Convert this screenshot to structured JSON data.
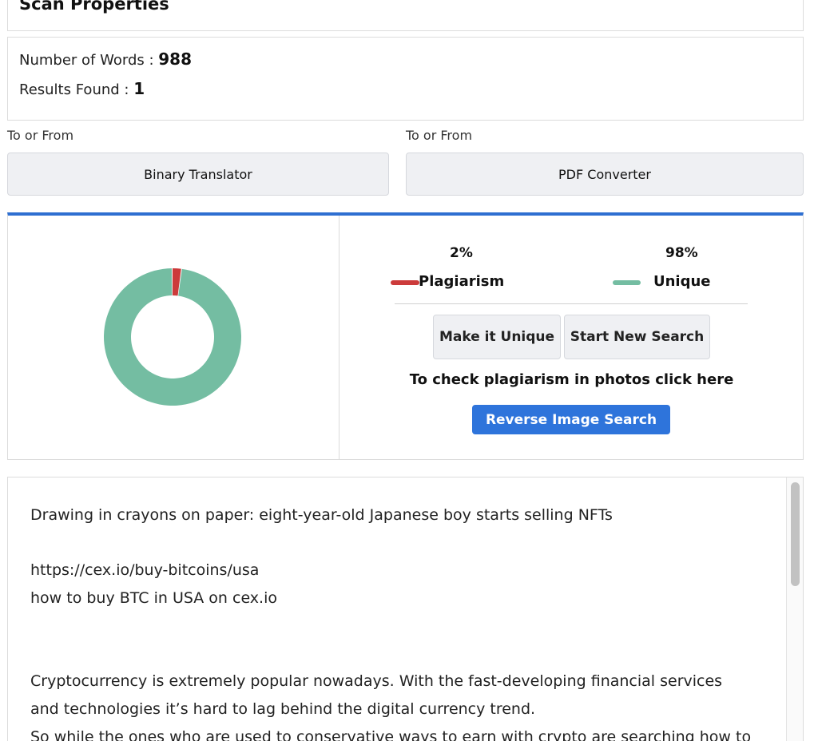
{
  "header": {
    "title": "Scan Properties"
  },
  "stats": {
    "words_label": "Number of Words : ",
    "words_value": "988",
    "results_label": "Results Found : ",
    "results_value": "1"
  },
  "tools": [
    {
      "label": "To or From",
      "button": "Binary Translator"
    },
    {
      "label": "To or From",
      "button": "PDF Converter"
    }
  ],
  "results": {
    "plagiarism": {
      "percent_text": "2%",
      "label": "Plagiarism",
      "value": 2,
      "color": "#cc3b3b"
    },
    "unique": {
      "percent_text": "98%",
      "label": "Unique",
      "value": 98,
      "color": "#74bda2"
    },
    "make_unique_button": "Make it Unique",
    "new_search_button": "Start New Search",
    "photo_hint": "To check plagiarism in photos click here",
    "reverse_image_button": "Reverse Image Search"
  },
  "content_lines": [
    "Drawing in crayons on paper: eight-year-old Japanese boy starts selling NFTs",
    "",
    "https://cex.io/buy-bitcoins/usa",
    "how to buy BTC in USA on cex.io",
    "",
    "",
    "Cryptocurrency is extremely popular nowadays. With the fast-developing financial services",
    "and technologies it’s hard to lag behind the digital currency trend.",
    "So while the ones who are used to conservative ways to earn with crypto are searching how to"
  ],
  "colors": {
    "accent": "#2e6fd1",
    "button_primary": "#2e74db"
  }
}
